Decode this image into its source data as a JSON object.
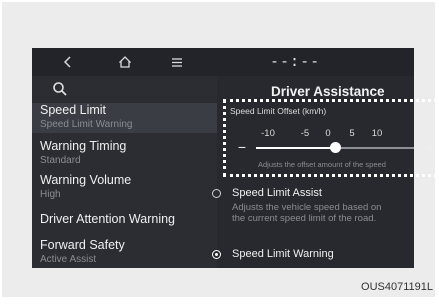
{
  "topbar": {
    "back_icon": "back-chevron-icon",
    "home_icon": "home-icon",
    "menu_icon": "menu-icon",
    "clock": "--:--"
  },
  "left_menu": {
    "search_icon": "search-icon",
    "items": [
      {
        "title": "Speed Limit",
        "subtitle": "Speed Limit Warning",
        "active": true
      },
      {
        "title": "Warning Timing",
        "subtitle": "Standard",
        "active": false
      },
      {
        "title": "Warning Volume",
        "subtitle": "High",
        "active": false
      },
      {
        "title": "Driver Attention Warning",
        "subtitle": "",
        "active": false
      },
      {
        "title": "Forward Safety",
        "subtitle": "Active Assist",
        "active": false
      }
    ]
  },
  "right_panel": {
    "title": "Driver Assistance",
    "offset": {
      "label": "Speed Limit Offset (km/h)",
      "ticks": [
        "-10",
        "-5",
        "0",
        "5",
        "10"
      ],
      "value": 0,
      "min": -10,
      "max": 10,
      "minus_label": "−",
      "plus_label": "+",
      "description": "Adjusts the offset amount of the speed"
    },
    "options": [
      {
        "label": "Speed Limit Assist",
        "description": "Adjusts the vehicle speed based on the current speed limit of the road.",
        "selected": false
      },
      {
        "label": "Speed Limit Warning",
        "description": "",
        "selected": true
      }
    ]
  },
  "caption": "OUS4071191L"
}
